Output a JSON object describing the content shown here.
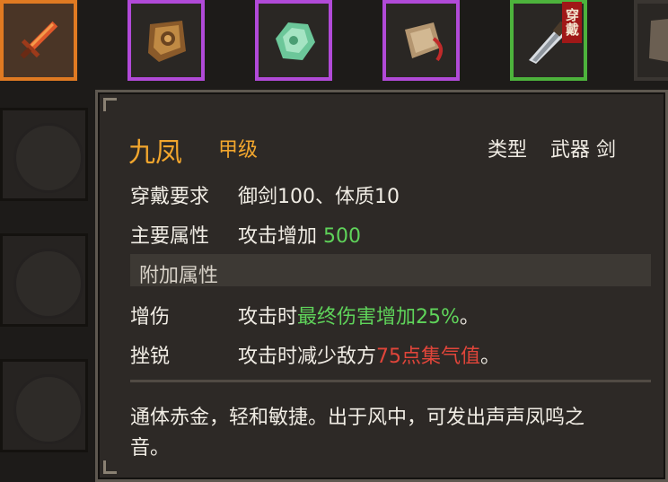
{
  "inventory": {
    "slots": [
      {
        "icon": "sword-icon",
        "rarity": "orange"
      },
      {
        "icon": "leather-armor-icon",
        "rarity": "purple"
      },
      {
        "icon": "jade-stone-icon",
        "rarity": "purple"
      },
      {
        "icon": "pouch-icon",
        "rarity": "purple"
      },
      {
        "icon": "dagger-icon",
        "rarity": "green",
        "tag": "穿戴"
      },
      {
        "icon": "armor-icon",
        "rarity": "plain"
      }
    ]
  },
  "item": {
    "name": "九凤",
    "grade": "甲级",
    "type_label": "类型",
    "type_value": "武器 剑",
    "req_label": "穿戴要求",
    "req_value": "御剑100、体质10",
    "main_label": "主要属性",
    "main_text": "攻击增加",
    "main_value": "500",
    "extra_header": "附加属性",
    "extra": [
      {
        "label": "增伤",
        "prefix": "攻击时",
        "highlight": "最终伤害增加25%",
        "suffix": "。",
        "color": "#5fd35a"
      },
      {
        "label": "挫锐",
        "prefix": "攻击时减少敌方",
        "highlight": "75点集气值",
        "suffix": "。",
        "color": "#e0453a"
      }
    ],
    "desc_line1": "通体赤金，轻和敏捷。出于风中，可发出声声凤鸣之",
    "desc_line2": "音。"
  }
}
